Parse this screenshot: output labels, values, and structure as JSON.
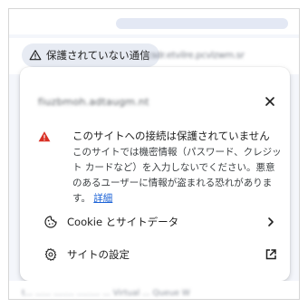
{
  "address_bar": {
    "security_chip_label": "保護されていない通信",
    "url_blurred": "csdr.etvilre.pcvlzwm.sr"
  },
  "popup": {
    "domain_blurred": "fiuzbmoh.adtaugm.nt",
    "warning": {
      "title": "このサイトへの接続は保護されていません",
      "body": "このサイトでは機密情報（パスワード、クレジット カードなど）を入力しないでください。悪意のあるユーザーに情報が盗まれる恐れがあります。",
      "link": "詳細"
    },
    "items": [
      {
        "label": "Cookie とサイトデータ",
        "icon": "cookie-icon",
        "trail_icon": "chevron-right-icon"
      },
      {
        "label": "サイトの設定",
        "icon": "gear-icon",
        "trail_icon": "open-external-icon"
      }
    ]
  },
  "background_text_blurred": "t... ...... ........ ......... ... Virtual ... Queue W",
  "colors": {
    "warning_red": "#d93025",
    "link_blue": "#1a61d6",
    "chip_bg": "#e7ebf3"
  }
}
